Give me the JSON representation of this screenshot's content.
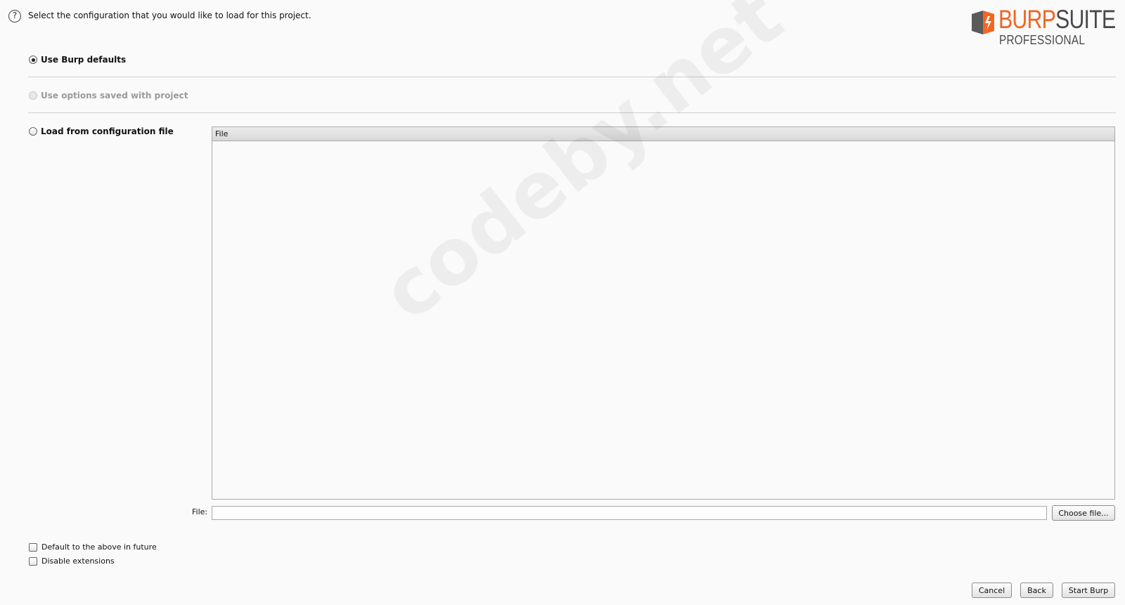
{
  "header": {
    "help_icon": "question-circle-icon",
    "help_glyph": "?",
    "instruction": "Select the configuration that you would like to load for this project."
  },
  "logo": {
    "brand_word_1": "BURP",
    "brand_word_2": "SUITE",
    "edition": "PROFESSIONAL",
    "brand_color": "#f26522",
    "text_color": "#4a4a4a"
  },
  "options": [
    {
      "label": "Use Burp defaults",
      "selected": true,
      "enabled": true
    },
    {
      "label": "Use options saved with project",
      "selected": false,
      "enabled": false
    },
    {
      "label": "Load from configuration file",
      "selected": false,
      "enabled": true
    }
  ],
  "file_table": {
    "columns": [
      "File"
    ],
    "rows": []
  },
  "file_field": {
    "label": "File:",
    "value": "",
    "choose_button": "Choose file..."
  },
  "checkboxes": [
    {
      "label": "Default to the above in future",
      "checked": false
    },
    {
      "label": "Disable extensions",
      "checked": false
    }
  ],
  "buttons": {
    "cancel": "Cancel",
    "back": "Back",
    "start": "Start Burp"
  },
  "watermark": "codeby.net"
}
